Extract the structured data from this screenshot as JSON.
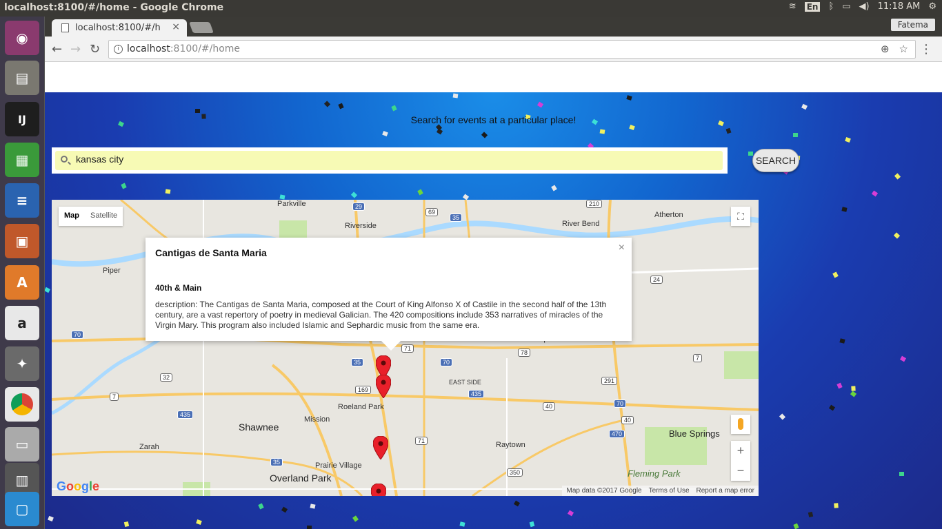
{
  "system": {
    "window_title": "localhost:8100/#/home - Google Chrome",
    "language": "En",
    "time": "11:18 AM"
  },
  "browser": {
    "tab_title": "localhost:8100/#/h",
    "tab_close": "×",
    "profile_name": "Fatema",
    "url_host": "localhost",
    "url_path": ":8100/#/home"
  },
  "launcher": {
    "apps": [
      "ubuntu-dash",
      "files",
      "intellij",
      "calc",
      "writer",
      "impress",
      "software-center",
      "amazon",
      "system-settings",
      "chrome",
      "disk",
      "scanner",
      "remote-desktop"
    ]
  },
  "page": {
    "heading": "Search for events at a particular place!",
    "search": {
      "value": "kansas city",
      "placeholder": ""
    },
    "search_button": "SEARCH"
  },
  "map": {
    "type_buttons": [
      "Map",
      "Satellite"
    ],
    "active_type": "Map",
    "zoom_in": "+",
    "zoom_out": "−",
    "logo": "Google",
    "footer": [
      "Map data ©2017 Google",
      "Terms of Use",
      "Report a map error"
    ],
    "places": [
      "Parkville",
      "Riverside",
      "River Bend",
      "Atherton",
      "Piper",
      "Independence",
      "EAST SIDE",
      "Roeland Park",
      "Mission",
      "Shawnee",
      "Zarah",
      "Raytown",
      "Blue Springs",
      "Prairie Village",
      "Overland Park",
      "Fleming Park"
    ],
    "infowindow": {
      "title": "Cantigas de Santa Maria",
      "address": "40th & Main",
      "description": "description: The Cantigas de Santa Maria, composed at the Court of King Alfonso X of Castile in the second half of the 13th century, are a vast repertory of poetry in medieval Galician. The 420 compositions include 353 narratives of miracles of the Virgin Mary. This program also included Islamic and Sephardic music from the same era.",
      "close": "×"
    },
    "shields": [
      "29",
      "69",
      "35",
      "210",
      "24",
      "70",
      "35",
      "71",
      "70",
      "78",
      "32",
      "169",
      "435",
      "291",
      "7",
      "7",
      "71",
      "40",
      "70",
      "40",
      "470",
      "435",
      "35",
      "350"
    ]
  },
  "colors": {
    "hero_top": "#1a8de8",
    "hero_bottom": "#1c2a8a",
    "search_bg": "#f7fab5",
    "pin": "#e8202a"
  }
}
